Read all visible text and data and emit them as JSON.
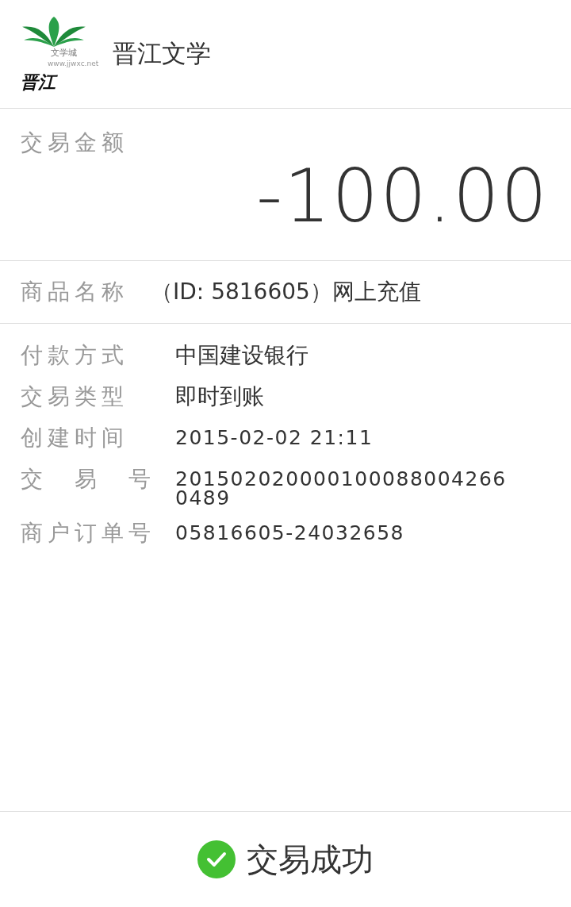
{
  "header": {
    "logo": {
      "mark": "晋江",
      "sub": "文学城",
      "url": "www.jjwxc.net"
    },
    "title": "晋江文学"
  },
  "amount": {
    "label": "交易金额",
    "value": "-100.00"
  },
  "product": {
    "label": "商品名称",
    "value": "（ID: 5816605）网上充值"
  },
  "details": [
    {
      "label": "付款方式",
      "value": "中国建设银行",
      "kind": "text"
    },
    {
      "label": "交易类型",
      "value": "即时到账",
      "kind": "text"
    },
    {
      "label": "创建时间",
      "value": "2015-02-02 21:11",
      "kind": "number"
    },
    {
      "label": "交　易　号",
      "value": "2015020200001000880042660489",
      "kind": "number"
    },
    {
      "label": "商户订单号",
      "value": "05816605-24032658",
      "kind": "number"
    }
  ],
  "status": {
    "text": "交易成功",
    "kind": "success"
  }
}
